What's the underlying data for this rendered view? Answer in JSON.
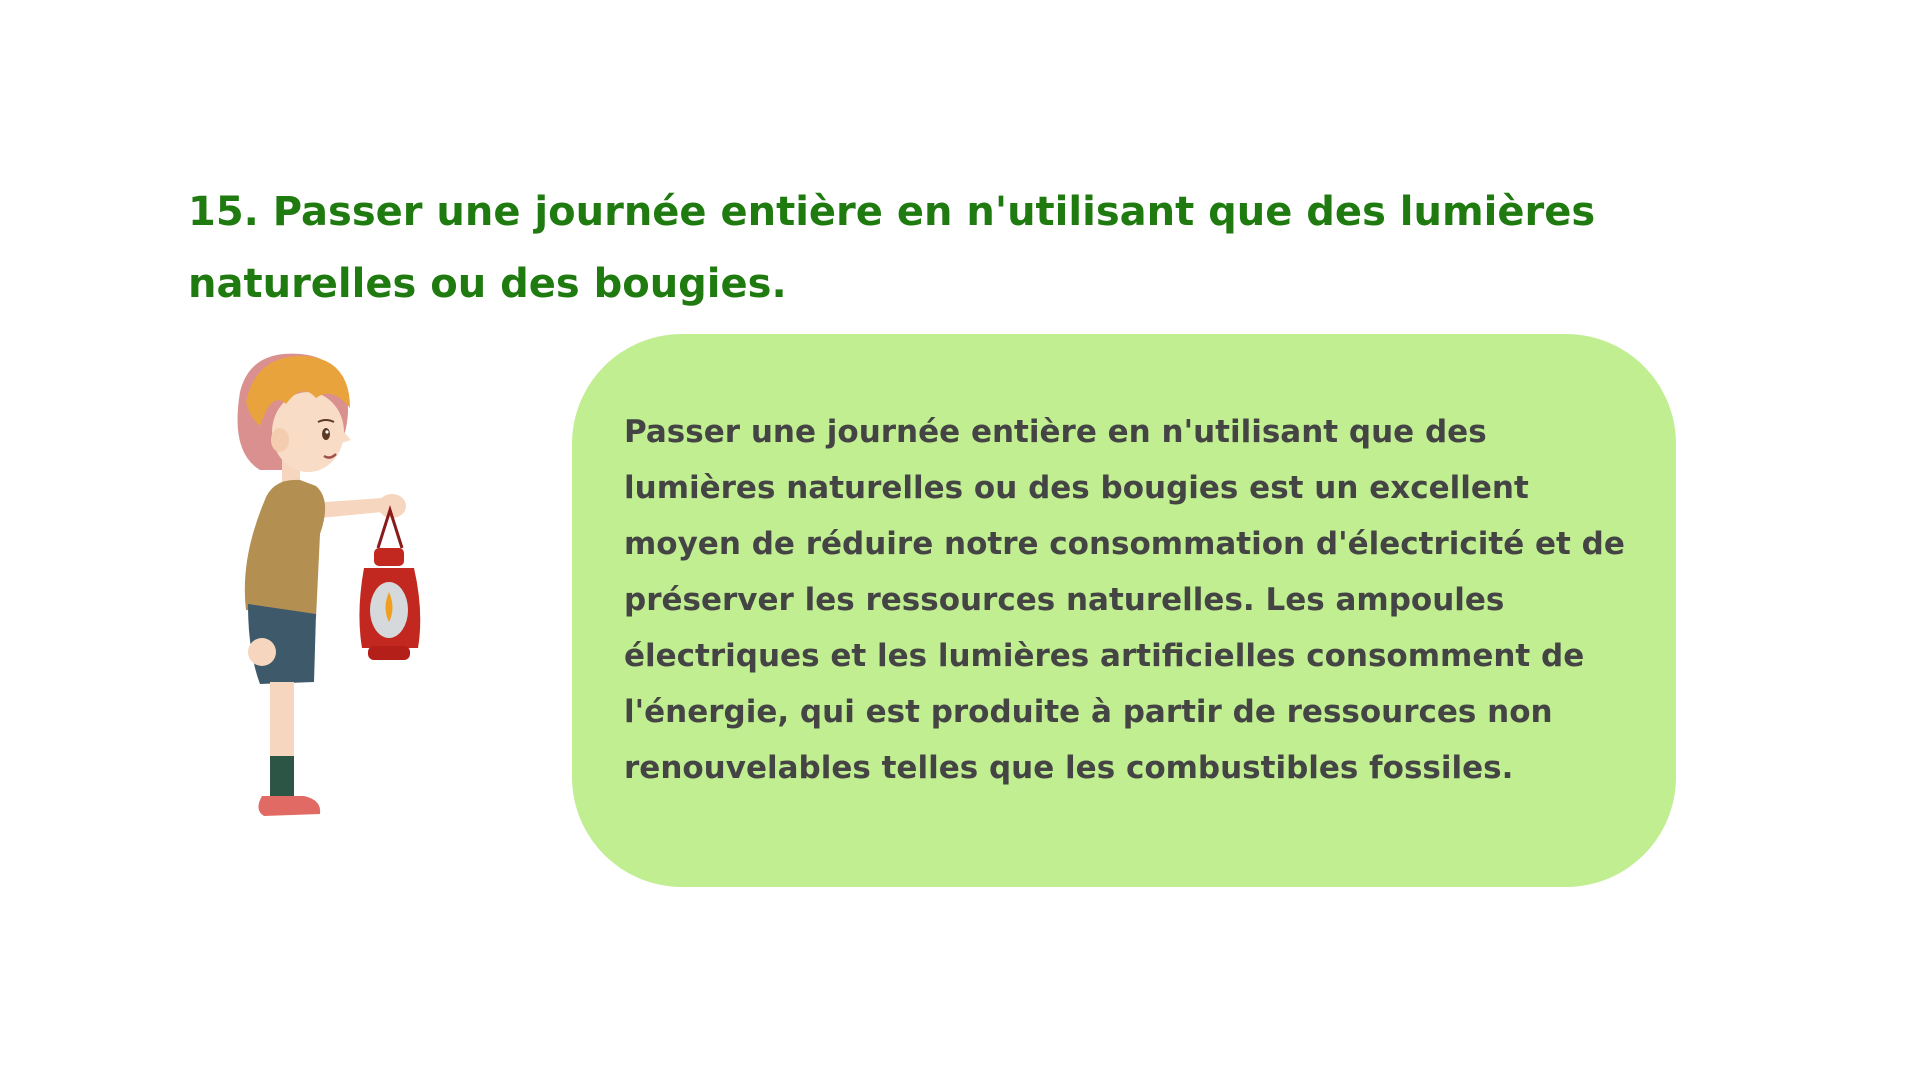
{
  "slide": {
    "title": "15. Passer une journée entière en n'utilisant que des lumières naturelles ou des bougies.",
    "body": "Passer une journée entière en n'utilisant que des lumières naturelles ou des bougies est un excellent moyen de réduire notre consommation d'électricité et de préserver les ressources naturelles. Les ampoules électriques et les lumières artificielles consomment de l'énergie, qui est produite à partir de ressources non renouvelables telles que les combustibles fossiles."
  },
  "illustration": {
    "icon": "girl-with-lantern-icon"
  },
  "colors": {
    "title": "#1f7a0f",
    "box": "#c0ee91",
    "text": "#444444"
  }
}
